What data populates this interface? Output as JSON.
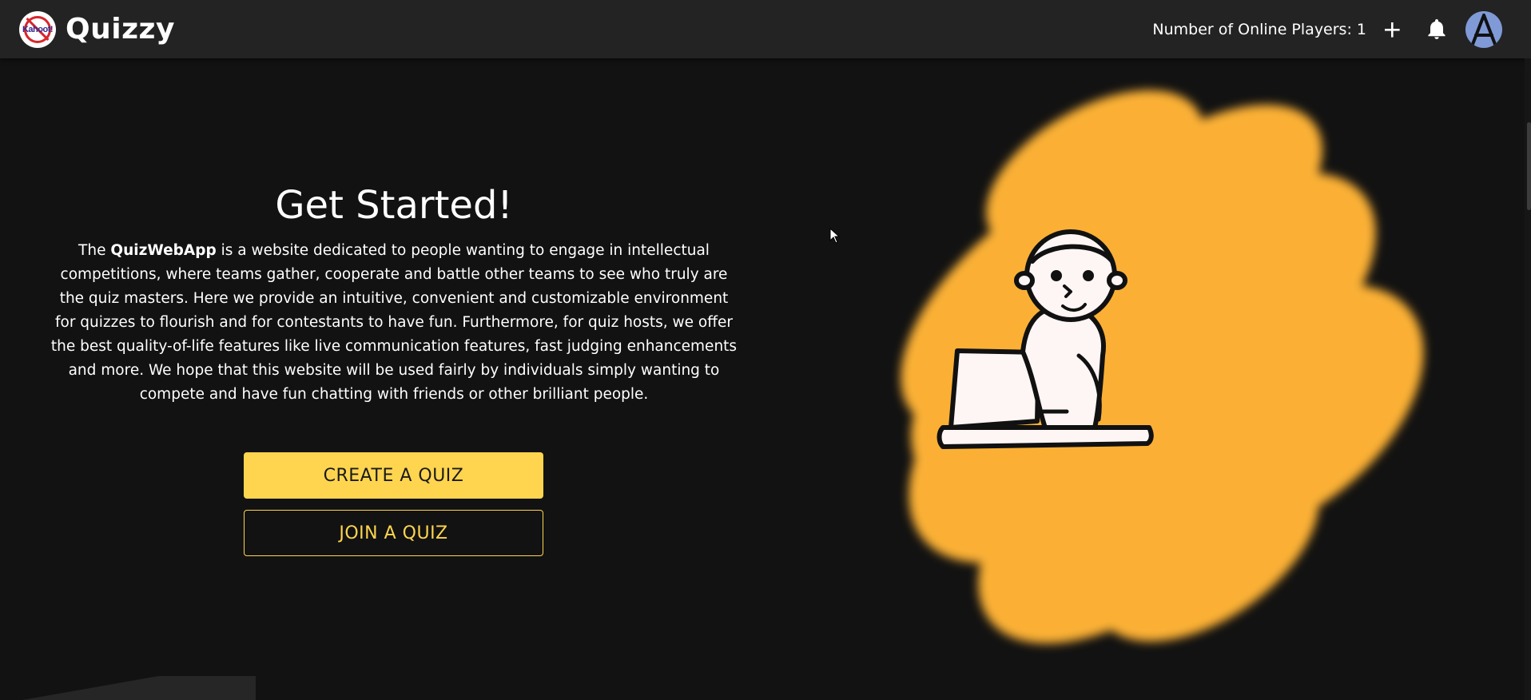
{
  "app": {
    "name": "Quizzy",
    "logo_text": "Kahoot!"
  },
  "header": {
    "online_players": "Number of Online Players: 1",
    "icons": {
      "add": "plus-icon",
      "notifications": "bell-icon",
      "avatar": "avatar-icon"
    },
    "avatar_letter": "A"
  },
  "hero": {
    "title": "Get Started!",
    "description_prefix": "The ",
    "description_bold": "QuizWebApp",
    "description_rest": " is a website dedicated to people wanting to engage in intellectual competitions, where teams gather, cooperate and battle other teams to see who truly are the quiz masters. Here we provide an intuitive, convenient and customizable environment for quizzes to flourish and for contestants to have fun. Furthermore, for quiz hosts, we offer the best quality-of-life features like live communication features, fast judging enhancements and more. We hope that this website will be used fairly by individuals simply wanting to compete and have fun chatting with friends or other brilliant people.",
    "create_button": "CREATE A QUIZ",
    "join_button": "JOIN A QUIZ"
  },
  "colors": {
    "background": "#121212",
    "appbar": "#232323",
    "accent": "#ffd54f",
    "illustration_blob": "#fbb034",
    "avatar": "#7f9ad6"
  }
}
